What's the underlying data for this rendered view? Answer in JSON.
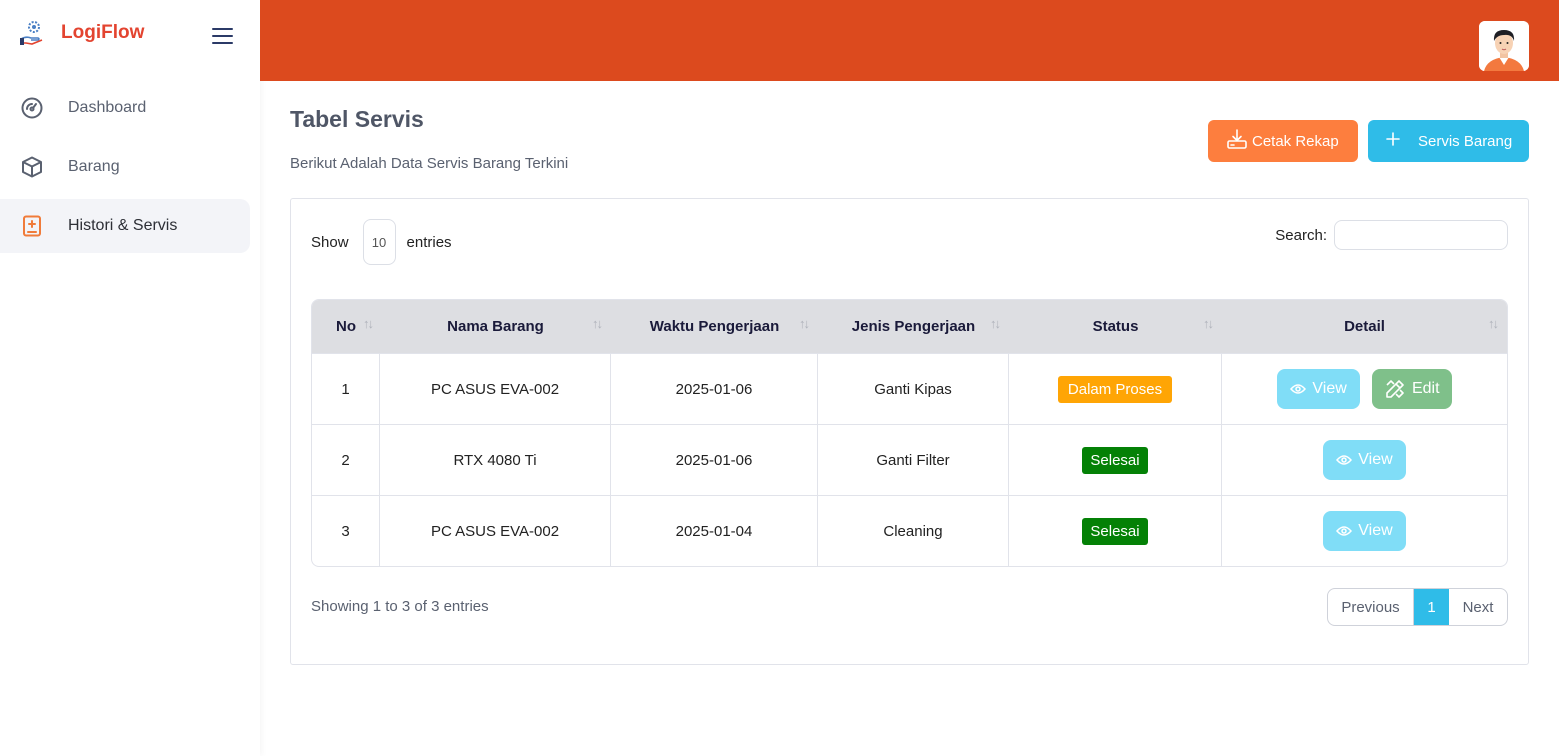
{
  "brand": {
    "name": "LogiFlow"
  },
  "sidebar": {
    "items": [
      {
        "label": "Dashboard",
        "icon": "gauge-icon"
      },
      {
        "label": "Barang",
        "icon": "box-icon"
      },
      {
        "label": "Histori & Servis",
        "icon": "clipboard-plus-icon",
        "active": true
      }
    ]
  },
  "header": {
    "accent": "#dc4a1e"
  },
  "page": {
    "title": "Tabel Servis",
    "subtitle": "Berikut Adalah Data Servis Barang Terkini",
    "buttons": {
      "rekap": "Cetak Rekap",
      "servis": "Servis Barang"
    }
  },
  "table": {
    "show_label": "Show",
    "entries_label": "entries",
    "page_length": "10",
    "search_label": "Search:",
    "search_value": "",
    "columns": [
      "No",
      "Nama Barang",
      "Waktu Pengerjaan",
      "Jenis Pengerjaan",
      "Status",
      "Detail"
    ],
    "rows": [
      {
        "no": "1",
        "nama": "PC ASUS EVA-002",
        "waktu": "2025-01-06",
        "jenis": "Ganti Kipas",
        "status": "Dalam Proses",
        "view": "View",
        "edit": "Edit"
      },
      {
        "no": "2",
        "nama": "RTX 4080 Ti",
        "waktu": "2025-01-06",
        "jenis": "Ganti Filter",
        "status": "Selesai",
        "view": "View"
      },
      {
        "no": "3",
        "nama": "PC ASUS EVA-002",
        "waktu": "2025-01-04",
        "jenis": "Cleaning",
        "status": "Selesai",
        "view": "View"
      }
    ],
    "info": "Showing 1 to 3 of 3 entries",
    "pagination": {
      "previous": "Previous",
      "current": "1",
      "next": "Next"
    }
  },
  "colors": {
    "orange_button": "#fd7e3e",
    "blue_button": "#2fbce8",
    "status_proses": "#ffa505",
    "status_selesai": "#048106"
  }
}
